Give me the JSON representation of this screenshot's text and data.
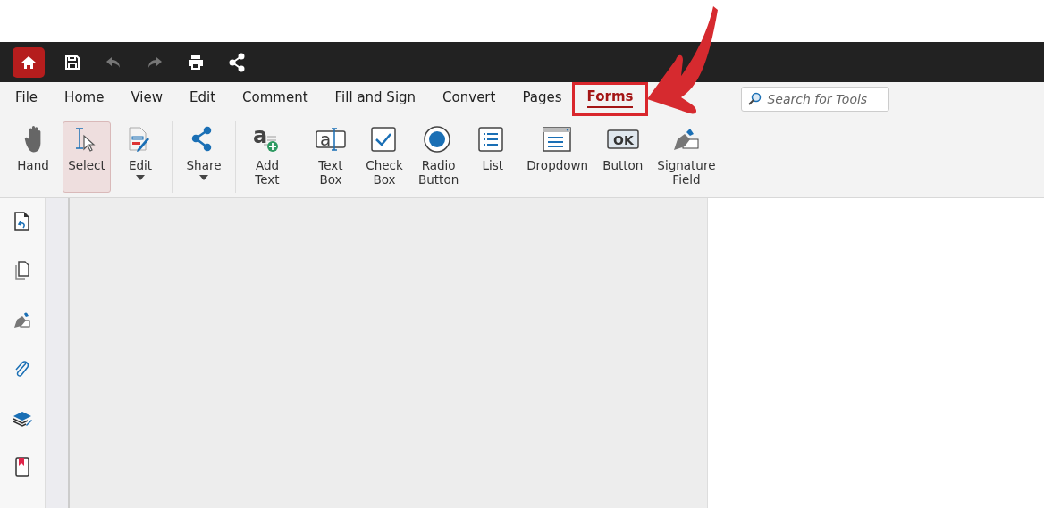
{
  "quick_toolbar": {
    "buttons": [
      {
        "kind": "home",
        "disabled": false
      },
      {
        "kind": "save",
        "disabled": false
      },
      {
        "kind": "undo",
        "disabled": true
      },
      {
        "kind": "redo",
        "disabled": true
      },
      {
        "kind": "print",
        "disabled": false
      },
      {
        "kind": "share",
        "disabled": false
      }
    ]
  },
  "menu": {
    "tabs": [
      {
        "label": "File",
        "selected": false,
        "highlighted": false
      },
      {
        "label": "Home",
        "selected": false,
        "highlighted": false
      },
      {
        "label": "View",
        "selected": false,
        "highlighted": false
      },
      {
        "label": "Edit",
        "selected": false,
        "highlighted": false
      },
      {
        "label": "Comment",
        "selected": false,
        "highlighted": false
      },
      {
        "label": "Fill and Sign",
        "selected": false,
        "highlighted": false
      },
      {
        "label": "Convert",
        "selected": false,
        "highlighted": false
      },
      {
        "label": "Pages",
        "selected": false,
        "highlighted": false
      },
      {
        "label": "Forms",
        "selected": true,
        "highlighted": true
      }
    ],
    "search": {
      "placeholder": "Search for Tools"
    }
  },
  "ribbon": {
    "groups": [
      [
        {
          "label": "Hand",
          "selected": false,
          "dropdown": false
        },
        {
          "label": "Select",
          "selected": true,
          "dropdown": false
        },
        {
          "label": "Edit",
          "selected": false,
          "dropdown": true
        }
      ],
      [
        {
          "label": "Share",
          "selected": false,
          "dropdown": true
        }
      ],
      [
        {
          "label": "Add Text",
          "selected": false,
          "dropdown": false,
          "icon_text": "a"
        }
      ],
      [
        {
          "label": "Text Box",
          "selected": false,
          "dropdown": false,
          "icon_text": "a"
        },
        {
          "label": "Check Box",
          "selected": false,
          "dropdown": false
        },
        {
          "label": "Radio Button",
          "selected": false,
          "dropdown": false
        },
        {
          "label": "List",
          "selected": false,
          "dropdown": false
        },
        {
          "label": "Dropdown",
          "selected": false,
          "dropdown": false
        },
        {
          "label": "Button",
          "selected": false,
          "dropdown": false,
          "icon_text": "OK"
        },
        {
          "label": "Signature Field",
          "selected": false,
          "dropdown": false
        }
      ]
    ]
  },
  "sidebar": {
    "buttons": [
      {
        "kind": "page-rotate"
      },
      {
        "kind": "pages"
      },
      {
        "kind": "signature"
      },
      {
        "kind": "attachment"
      },
      {
        "kind": "layers"
      },
      {
        "kind": "bookmark"
      }
    ]
  },
  "annotation": {
    "kind": "arrow"
  }
}
